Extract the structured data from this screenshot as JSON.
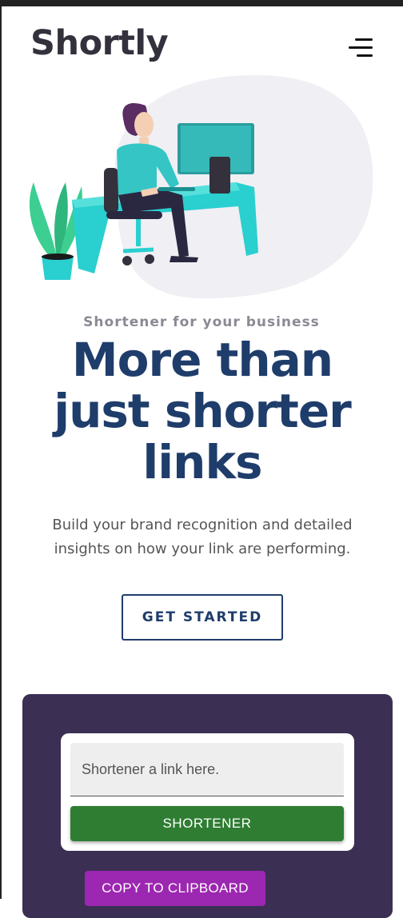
{
  "header": {
    "logo_text": "Shortly",
    "menu_icon": "hamburger-menu-icon"
  },
  "hero": {
    "illustration": "person-working-at-desk-illustration",
    "eyebrow": "Shortener for your business",
    "title_line1": "More than",
    "title_line2": "just shorter",
    "title_line3": "links",
    "description": "Build your brand recognition and detailed insights on how your link are performing.",
    "cta_label": "GET STARTED"
  },
  "shortener": {
    "input_placeholder": "Shortener a link here.",
    "input_value": "",
    "submit_label": "SHORTENER",
    "copy_label": "COPY TO CLIPBOARD"
  },
  "colors": {
    "brand_dark": "#34313d",
    "headline": "#1f3d6b",
    "section_bg": "#3b2f54",
    "submit_button": "#2e7d32",
    "copy_button": "#9c27b0",
    "accent_cyan": "#2acfcf"
  }
}
